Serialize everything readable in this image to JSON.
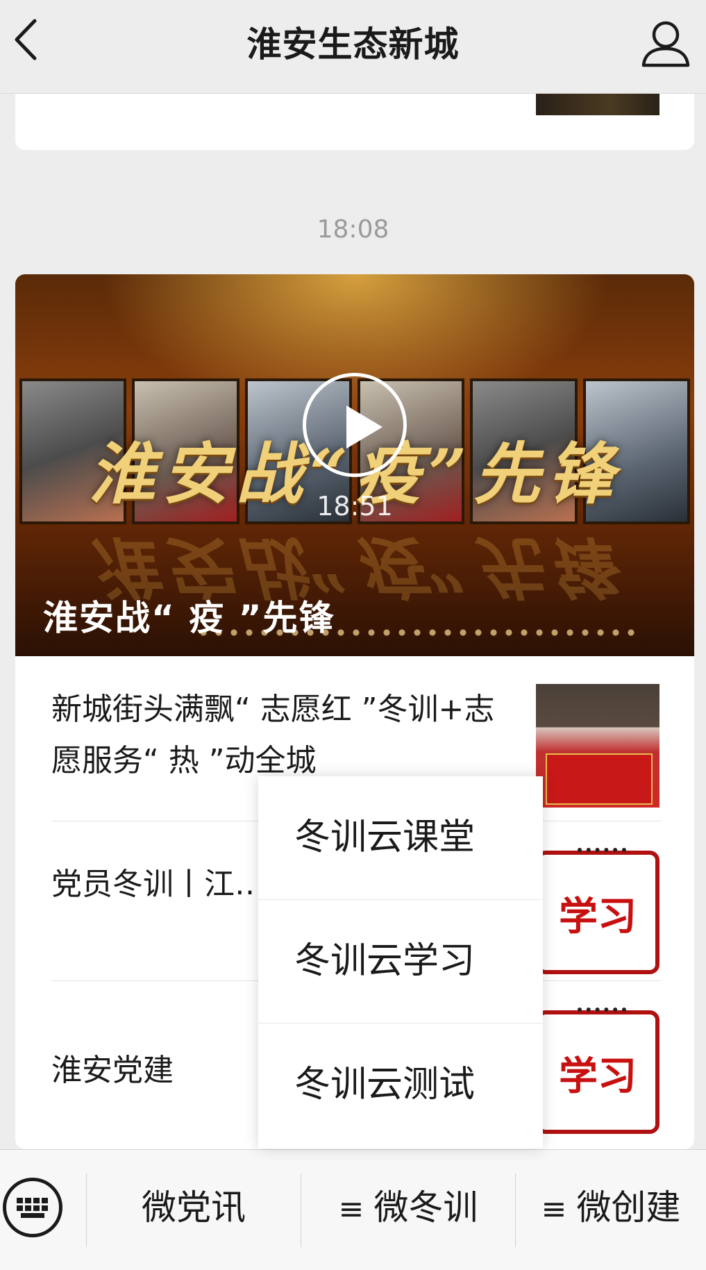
{
  "header": {
    "title": "淮安生态新城",
    "back_icon": "chevron-left-icon",
    "profile_icon": "person-icon"
  },
  "feed": {
    "timestamp": "18:08",
    "article": {
      "hero": {
        "image_text": "淮安战“疫”先锋",
        "duration": "18:51",
        "title": "淮安战“ 疫 ”先锋"
      },
      "items": [
        {
          "title": "新城街头满飘“ 志愿红 ”冬训+志愿服务“ 热 ”动全城"
        },
        {
          "title": "党员冬训丨江…区：创新“ 冬…"
        },
        {
          "title": "淮安党建"
        }
      ],
      "study_label": "学习"
    }
  },
  "popup_menu": {
    "items": [
      "冬训云课堂",
      "冬训云学习",
      "冬训云测试"
    ]
  },
  "bottom_bar": {
    "keyboard_icon": "keyboard-icon",
    "tabs": [
      {
        "label": "微党讯"
      },
      {
        "label": "微冬训",
        "glyph": "≡"
      },
      {
        "label": "微创建",
        "glyph": "≡"
      }
    ]
  }
}
